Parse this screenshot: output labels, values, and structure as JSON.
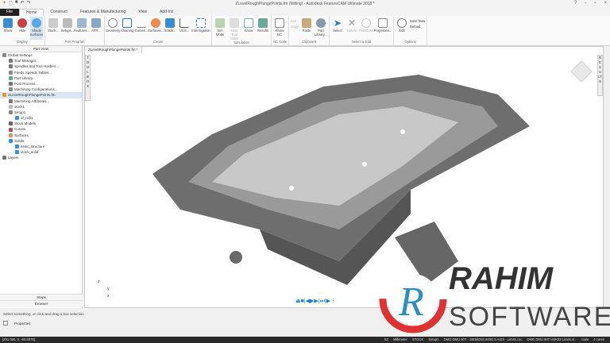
{
  "titlebar": {
    "title": "ZLevelRoughPlungePoints.fm (Milling) - Autodesk FeatureCAM Ultimate 2018 *",
    "help": "?",
    "minimize": "-",
    "maximize": "▫",
    "close": "×"
  },
  "tabs": [
    "File",
    "Home",
    "Construct",
    "Features & Manufacturing",
    "View",
    "Add-Ins"
  ],
  "ribbon": {
    "groups": [
      {
        "label": "Display",
        "buttons": [
          "Show",
          "Hide",
          "Shade Surfaces"
        ]
      },
      {
        "label": "Part Program",
        "buttons": [
          "Stock...",
          "Setups...",
          "Features...",
          "AFR..."
        ]
      },
      {
        "label": "Create",
        "buttons": [
          "Geometry",
          "Chaining",
          "Curves...",
          "Surfaces...",
          "Solids...",
          "UCS...",
          "Interrogation"
        ]
      },
      {
        "label": "Simulation",
        "buttons": [
          "Sim Mode",
          "Next Tool Color",
          "Show",
          "Results"
        ]
      },
      {
        "label": "NC Code",
        "buttons": [
          "Show NC"
        ]
      },
      {
        "label": "Clipboard",
        "small": [
          "Cut",
          "Copy"
        ],
        "buttons": [
          "Paste",
          "Part Library..."
        ]
      },
      {
        "label": "Select & Edit",
        "buttons": [
          "Select",
          "Delete",
          "Transform",
          "Properties..."
        ]
      },
      {
        "label": "Options",
        "buttons": [
          "Edit"
        ],
        "small": [
          "Save Now",
          "Reload"
        ]
      }
    ]
  },
  "part_view": {
    "header": "Part View",
    "items": [
      "Global Settings",
      "Tool Manager...",
      "Spindles and Tool Holders...",
      "Feeds Speeds Tables...",
      "Part Library...",
      "Post Process...",
      "Machining Configurations...",
      "ZLevelRoughPlungePoints.fm",
      "Machining Attributes...",
      "stock1",
      "Setup1",
      "af_mill1",
      "Stock Models",
      "Curves",
      "Surfaces",
      "Solids",
      "assic_structure",
      "stock_solid",
      "Layers"
    ],
    "bottom": [
      "Steps",
      "Browser"
    ]
  },
  "viewport": {
    "tab": "ZLevelRoughPlungePoints.fm *",
    "left_strip": "TOOLBOX",
    "right_strip": "RESULTS",
    "axes": [
      "z",
      "y",
      "x"
    ],
    "playback": "⏏■|◀▶▶|⏭|▶⋮"
  },
  "message": "Select something, or click-and-drag a box selection",
  "properties": "Properties",
  "status": {
    "coords": "[291.066, 0, -60.5976]",
    "items": [
      "XZ",
      "Millimeter",
      "STOCK",
      "Setup1",
      "DMG DMU 60T - SIEMENS 840D 5 AXIS - Limits.cnc",
      "DMG DMU 60T HSK63 Limits.xl...",
      "tools",
      "4 cores"
    ]
  },
  "watermark": {
    "line1": "RAHIM",
    "line2": "SOFTWARES",
    "letter": "R"
  }
}
